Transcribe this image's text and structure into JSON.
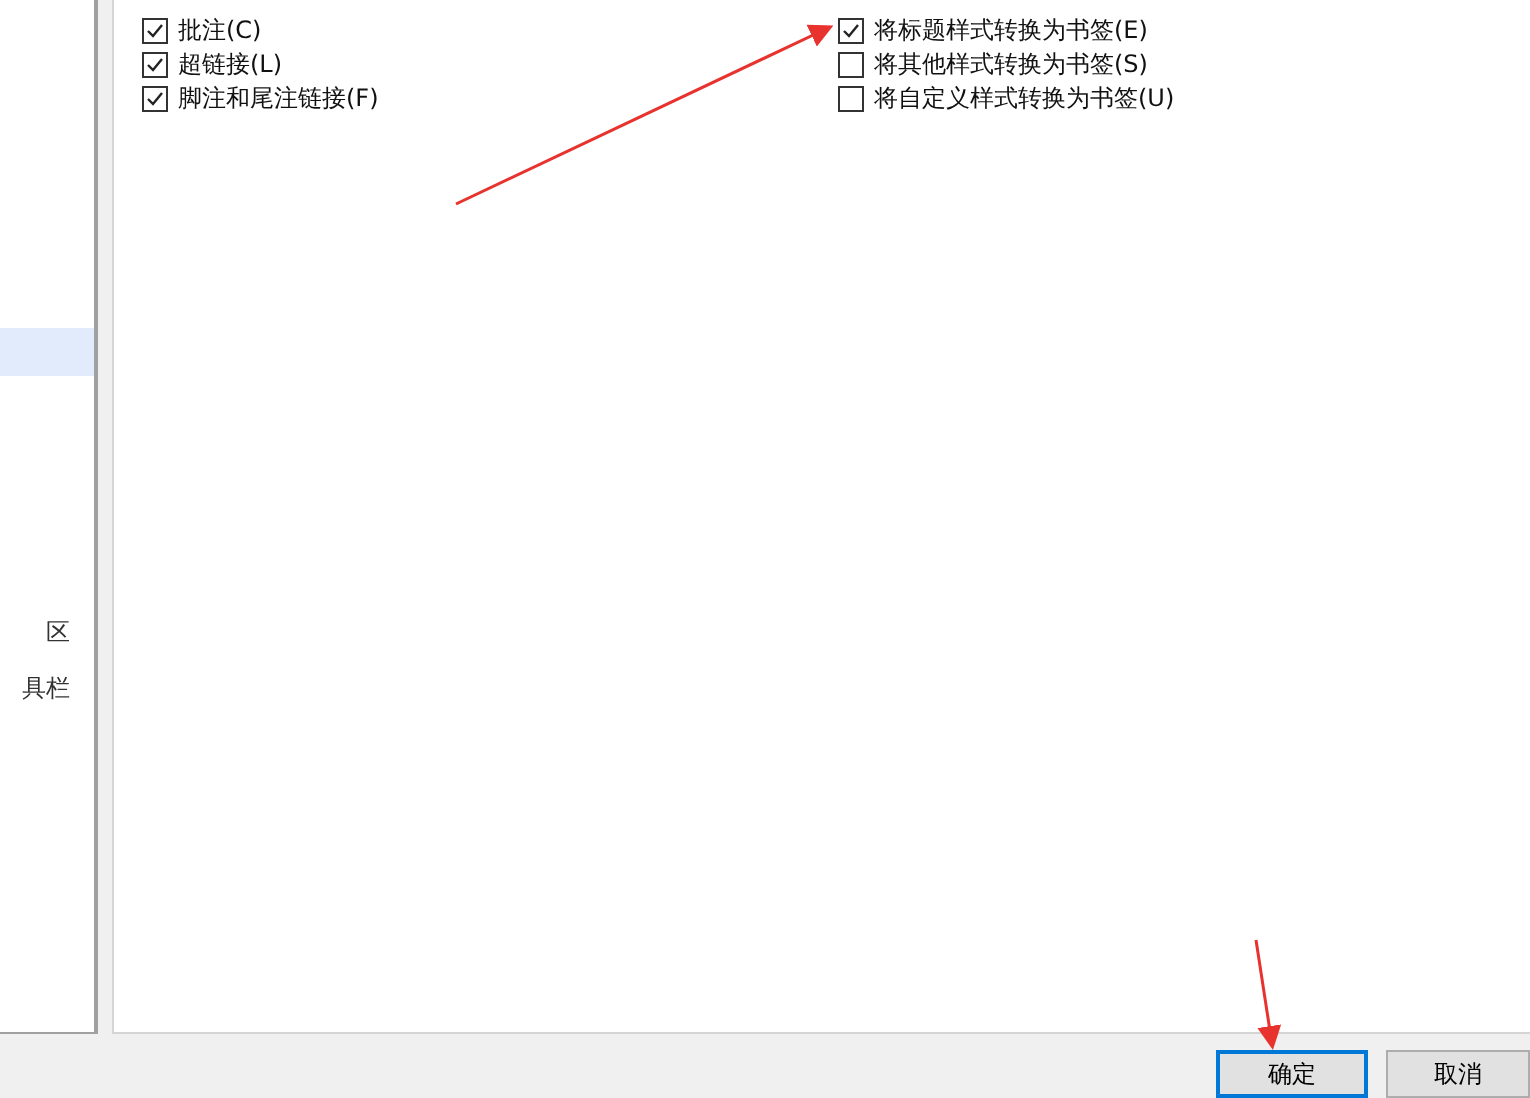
{
  "sidebar": {
    "items": [
      {
        "selected": true
      },
      {
        "label": "区",
        "selected": false
      },
      {
        "label": "具栏",
        "selected": false
      }
    ]
  },
  "options": {
    "left": [
      {
        "label": "批注(C)",
        "checked": true
      },
      {
        "label": "超链接(L)",
        "checked": true
      },
      {
        "label": "脚注和尾注链接(F)",
        "checked": true
      }
    ],
    "right": [
      {
        "label": "将标题样式转换为书签(E)",
        "checked": true
      },
      {
        "label": "将其他样式转换为书签(S)",
        "checked": false
      },
      {
        "label": "将自定义样式转换为书签(U)",
        "checked": false
      }
    ]
  },
  "buttons": [
    {
      "label": "确定",
      "kind": "primary"
    },
    {
      "label": "取消",
      "kind": "normal"
    }
  ]
}
